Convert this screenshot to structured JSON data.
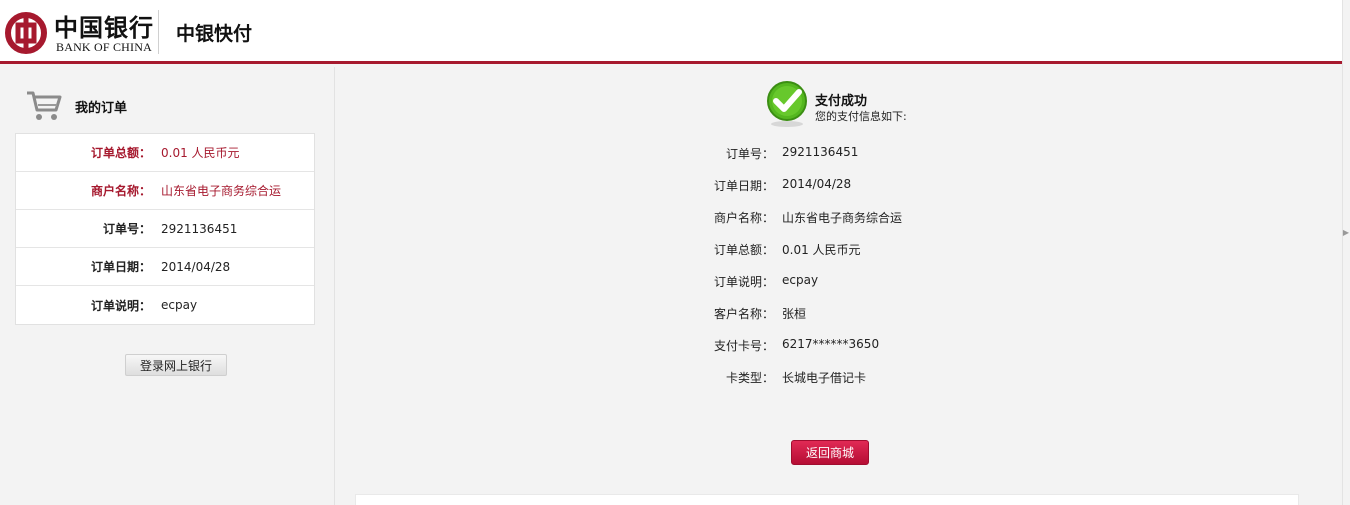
{
  "header": {
    "logo_cn": "中国银行",
    "logo_en": "BANK OF CHINA",
    "title": "中银快付"
  },
  "sidebar": {
    "heading": "我的订单",
    "order_rows": [
      {
        "label": "订单总额：",
        "value": "0.01 人民币元"
      },
      {
        "label": "商户名称：",
        "value": "山东省电子商务综合运"
      },
      {
        "label": "订单号：",
        "value": "2921136451"
      },
      {
        "label": "订单日期：",
        "value": "2014/04/28"
      },
      {
        "label": "订单说明：",
        "value": "ecpay"
      }
    ],
    "login_button": "登录网上银行"
  },
  "main": {
    "success_title": "支付成功",
    "success_subtitle": "您的支付信息如下:",
    "details": [
      {
        "label": "订单号：",
        "value": "2921136451"
      },
      {
        "label": "订单日期：",
        "value": "2014/04/28"
      },
      {
        "label": "商户名称：",
        "value": "山东省电子商务综合运"
      },
      {
        "label": "订单总额：",
        "value": "0.01 人民币元"
      },
      {
        "label": "订单说明：",
        "value": "ecpay"
      },
      {
        "label": "客户名称：",
        "value": "张桓"
      },
      {
        "label": "支付卡号：",
        "value": "6217******3650"
      },
      {
        "label": "卡类型：",
        "value": "长城电子借记卡"
      }
    ],
    "back_button": "返回商城"
  },
  "colors": {
    "brand_red": "#a6192e",
    "button_red": "#d01a45",
    "success_green": "#54b71f"
  },
  "icons": {
    "logo": "bank-of-china-logo-icon",
    "cart": "shopping-cart-icon",
    "success": "checkmark-circle-icon"
  }
}
